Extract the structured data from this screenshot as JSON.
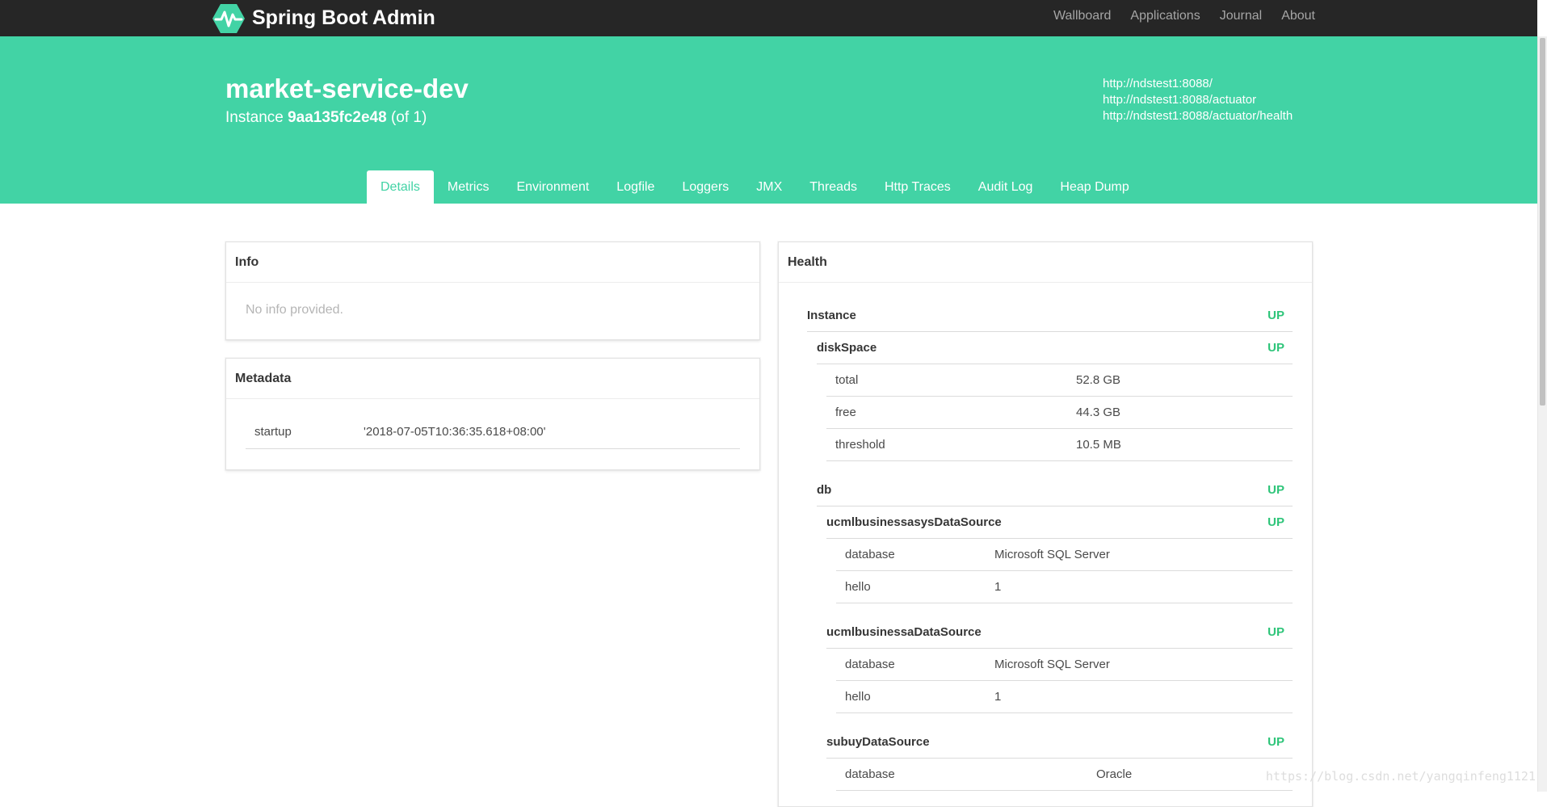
{
  "navbar": {
    "brand": "Spring Boot Admin",
    "links": [
      "Wallboard",
      "Applications",
      "Journal",
      "About"
    ]
  },
  "hero": {
    "title": "market-service-dev",
    "instance_prefix": "Instance",
    "instance_id": "9aa135fc2e48",
    "instance_count": "(of 1)",
    "urls": [
      "http://ndstest1:8088/",
      "http://ndstest1:8088/actuator",
      "http://ndstest1:8088/actuator/health"
    ]
  },
  "tabs": [
    "Details",
    "Metrics",
    "Environment",
    "Logfile",
    "Loggers",
    "JMX",
    "Threads",
    "Http Traces",
    "Audit Log",
    "Heap Dump"
  ],
  "info": {
    "title": "Info",
    "empty": "No info provided."
  },
  "metadata": {
    "title": "Metadata",
    "rows": [
      {
        "key": "startup",
        "value": "'2018-07-05T10:36:35.618+08:00'"
      }
    ]
  },
  "health": {
    "title": "Health",
    "instance": {
      "label": "Instance",
      "status": "UP"
    },
    "diskSpace": {
      "label": "diskSpace",
      "status": "UP",
      "details": [
        {
          "key": "total",
          "value": "52.8 GB"
        },
        {
          "key": "free",
          "value": "44.3 GB"
        },
        {
          "key": "threshold",
          "value": "10.5 MB"
        }
      ]
    },
    "db": {
      "label": "db",
      "status": "UP"
    },
    "sources": [
      {
        "label": "ucmlbusinessasysDataSource",
        "status": "UP",
        "details": [
          {
            "key": "database",
            "value": "Microsoft SQL Server"
          },
          {
            "key": "hello",
            "value": "1"
          }
        ]
      },
      {
        "label": "ucmlbusinessaDataSource",
        "status": "UP",
        "details": [
          {
            "key": "database",
            "value": "Microsoft SQL Server"
          },
          {
            "key": "hello",
            "value": "1"
          }
        ]
      },
      {
        "label": "subuyDataSource",
        "status": "UP",
        "details": [
          {
            "key": "database",
            "value": "Oracle"
          }
        ]
      }
    ]
  },
  "watermark": "https://blog.csdn.net/yangqinfeng1121",
  "colors": {
    "accent": "#42d3a5",
    "navbar": "#262626",
    "status_up": "#2fc57a"
  }
}
